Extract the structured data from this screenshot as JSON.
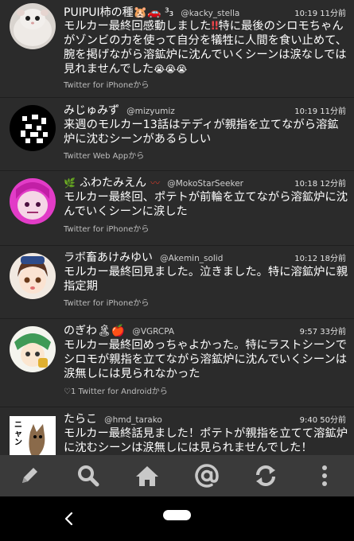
{
  "tweets": [
    {
      "name": "PUIPUI柿の種🐹🚗 ³₃",
      "handle": "@kacky_stella",
      "time": "10:19 11分前",
      "text_a": "モルカー最終回感動しました",
      "text_mark": "‼",
      "text_b": "特に最後のシロモちゃんがゾンビの力を使って自分を犠牲に人間を食い止めて、腕を掲げながら溶鉱炉に沈んでいくシーンは涙なしでは見れませんでした",
      "text_faces": "😭😭😭",
      "source": "Twitter for iPhoneから"
    },
    {
      "name": "みじゅみず",
      "handle": "@mizyumiz",
      "time": "10:19 11分前",
      "text": "来週のモルカー13話はテディが親指を立てながら溶鉱炉に沈むシーンがあるらしい",
      "source": "Twitter Web Appから"
    },
    {
      "name_icon": "🌿",
      "name": "ふわたみえん",
      "name_icon2": "〰",
      "handle": "@MokoStarSeeker",
      "time": "10:18 12分前",
      "text": "モルカー最終回、ポテトが前輪を立てながら溶鉱炉に沈んでいくシーンに涙した",
      "source": "Twitter for iPhoneから"
    },
    {
      "name": "ラボ畜あけみゆい",
      "handle": "@Akemin_solid",
      "time": "10:12 18分前",
      "text": "モルカー最終回見ました。泣きました。特に溶鉱炉に親指定期",
      "source": "Twitter for iPhoneから"
    },
    {
      "name": "のぎわ🏝🍎",
      "handle": "@VGRCPA",
      "time": "9:57 33分前",
      "text": "モルカー最終回めっちゃよかった。特にラストシーンでシロモが親指を立てながら溶鉱炉に沈んでいくシーンは涙無しには見られなかった",
      "source": "♡1 Twitter for Androidから"
    },
    {
      "name": "たらこ",
      "handle": "@hmd_tarako",
      "time": "9:40 50分前",
      "text": "モルカー最終話見ました！ポテトが親指を立てて溶鉱炉に沈むシーンは涙無しには見られませんでした！"
    }
  ],
  "avatar_badge": "ニャン",
  "toolbar": {
    "icons": [
      "pencil-icon",
      "search-icon",
      "home-icon",
      "mention-icon",
      "refresh-icon",
      "more-icon"
    ]
  },
  "colors": {
    "background": "#2b2b2b",
    "toolbar": "#3a3a3a",
    "navbar": "#000000",
    "secondary_text": "#bdbdbd",
    "icon": "#c8c8c8"
  }
}
